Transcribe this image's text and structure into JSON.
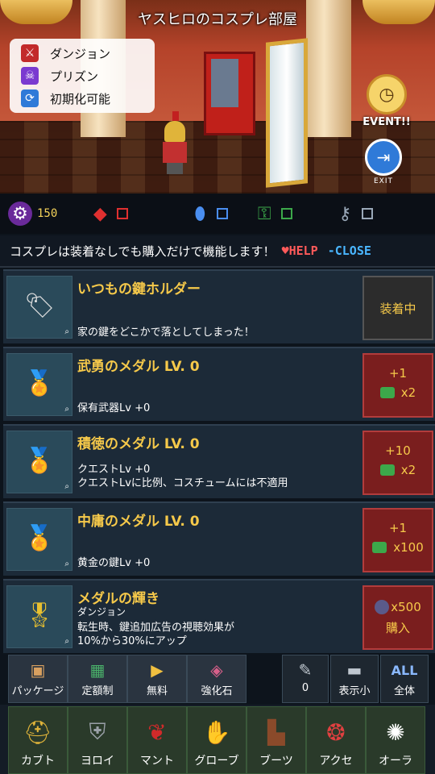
{
  "room": {
    "title": "ヤスヒロのコスプレ部屋",
    "status_list": [
      {
        "icon": "sword-icon",
        "label": "ダンジョン",
        "color": "#c22a2a"
      },
      {
        "icon": "skull-icon",
        "label": "プリズン",
        "color": "#7a3ad0"
      },
      {
        "icon": "refresh-icon",
        "label": "初期化可能",
        "color": "#2f7ad8"
      }
    ],
    "event_label": "EVENT!!",
    "exit_label": "EXIT"
  },
  "currency": {
    "ticket_value": "150",
    "items": [
      {
        "icon": "ruby-icon",
        "color": "#e03030"
      },
      {
        "icon": "blue-crystal-icon",
        "color": "#4a8ef0"
      },
      {
        "icon": "green-key-icon",
        "color": "#3ca84a"
      },
      {
        "icon": "silver-key-icon",
        "color": "#9aa8b8"
      }
    ]
  },
  "info": {
    "text": "コスプレは装着なしでも購入だけで機能します！",
    "help": "♥HELP",
    "close": "-CLOSE"
  },
  "items": [
    {
      "name": "いつもの鍵ホルダー",
      "sub": "",
      "desc": [
        "家の鍵をどこかで落としてしまった！"
      ],
      "btn1": "装着中",
      "btn2": "",
      "equipped": true
    },
    {
      "name": "武勇のメダル LV. 0",
      "sub": "",
      "desc": [
        "保有武器Lv +0"
      ],
      "btn1": "+1",
      "btn2": "x2",
      "equipped": false
    },
    {
      "name": "積徳のメダル LV. 0",
      "sub": "",
      "desc": [
        "クエストLv +0",
        "クエストLvに比例、コスチュームには不適用"
      ],
      "btn1": "+10",
      "btn2": "x2",
      "equipped": false
    },
    {
      "name": "中庸のメダル LV. 0",
      "sub": "",
      "desc": [
        "黄金の鍵Lv +0"
      ],
      "btn1": "+1",
      "btn2": "x100",
      "equipped": false
    },
    {
      "name": "メダルの輝き",
      "sub": "ダンジョン",
      "desc": [
        "転生時、鍵追加広告の視聴効果が",
        "10%から30%にアップ"
      ],
      "btn1": "x500",
      "btn2": "購入",
      "equipped": false
    }
  ],
  "tabs": [
    {
      "label": "パッケージ",
      "icon": "package-icon"
    },
    {
      "label": "定額制",
      "icon": "calendar-icon"
    },
    {
      "label": "無料",
      "icon": "video-icon"
    },
    {
      "label": "強化石",
      "icon": "stone-icon"
    }
  ],
  "tools": [
    {
      "label": "0",
      "icon": "ticket-icon"
    },
    {
      "label": "表示小",
      "icon": "display-small-icon"
    },
    {
      "label": "全体",
      "icon": "all-icon",
      "icon_text": "ALL"
    }
  ],
  "equip_tabs": [
    {
      "label": "カブト",
      "icon": "helmet-icon"
    },
    {
      "label": "ヨロイ",
      "icon": "armor-icon"
    },
    {
      "label": "マント",
      "icon": "cape-icon"
    },
    {
      "label": "グローブ",
      "icon": "glove-icon"
    },
    {
      "label": "ブーツ",
      "icon": "boots-icon"
    },
    {
      "label": "アクセ",
      "icon": "necklace-icon"
    },
    {
      "label": "オーラ",
      "icon": "aura-icon"
    }
  ]
}
